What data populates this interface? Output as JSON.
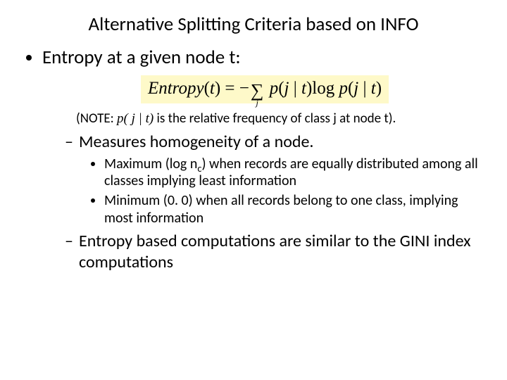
{
  "title": "Alternative Splitting Criteria based on INFO",
  "bullet1": "Entropy at a given node t:",
  "formula": {
    "lhs": "Entropy",
    "lparen": "(",
    "t": "t",
    "rparen": ")",
    "eq": " = ",
    "neg": "−",
    "sigma": "∑",
    "sigma_sub": "j",
    "p1a": "p",
    "p1b": "(",
    "p1c": "j",
    "p1d": " | ",
    "p1e": "t",
    "p1f": ")",
    "log": "log",
    "sp": " ",
    "p2a": "p",
    "p2b": "(",
    "p2c": "j",
    "p2d": " | ",
    "p2e": "t",
    "p2f": ")"
  },
  "note_prefix": "(NOTE: ",
  "note_expr": "p( j | t)",
  "note_suffix": " is the relative frequency of class j at node t).",
  "l2_a": "Measures homogeneity of a node.",
  "l3_a_pre": "Maximum (log n",
  "l3_a_sub": "c",
  "l3_a_post": ") when records are equally distributed among all classes implying least information",
  "l3_b": "Minimum (0. 0) when all records belong to one class, implying most information",
  "l2_b": "Entropy based computations are similar to the GINI index computations"
}
